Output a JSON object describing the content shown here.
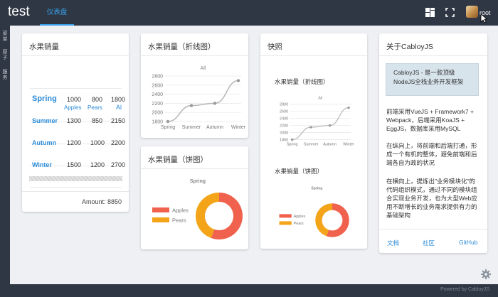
{
  "header": {
    "app_title": "test",
    "active_tab": "仪表盘",
    "user_name": "root"
  },
  "sidebar": {
    "items": [
      {
        "label": "菜单"
      },
      {
        "label": "原子"
      },
      {
        "label": "服务"
      }
    ]
  },
  "sales_table": {
    "title": "水果销量",
    "columns": [
      "Apples",
      "Pears",
      "Al"
    ],
    "rows": [
      {
        "season": "Spring",
        "apples": "1000",
        "pears": "800",
        "third": "1800"
      },
      {
        "season": "Summer",
        "apples": "1300",
        "pears": "850",
        "third": "2150"
      },
      {
        "season": "Autumn",
        "apples": "1200",
        "pears": "1000",
        "third": "2200"
      },
      {
        "season": "Winter",
        "apples": "1500",
        "pears": "1200",
        "third": "2700"
      }
    ],
    "amount_text": "Amount: 8850"
  },
  "line_card": {
    "title": "水果销量（折线图）"
  },
  "pie_card": {
    "title": "水果销量（饼图）"
  },
  "snapshot_card": {
    "title": "快照",
    "line_title": "水果销量（折线图）",
    "pie_title": "水果销量（饼图）"
  },
  "about_card": {
    "title": "关于CabloyJS",
    "highlight_line1": "CabloyJS - 是一款顶级",
    "highlight_line2": "NodeJS全栈业务开发框架",
    "p1": "前端采用VueJS + Framework7 + Webpack，后端采用KoaJS + EggJS，数据库采用MySQL",
    "p2": "在纵向上，将前端和后端打通，形成一个有机的整体，避免前端和后端各自为政的状况",
    "p3": "在横向上，提炼出\"业务模块化\"的代码组织模式，通过不同的模块组合实现业务开发，也为大型Web应用不断增长的业务需求提供有力的基础架构",
    "link_docs": "文档",
    "link_community": "社区",
    "link_github": "GitHub"
  },
  "footer": {
    "text": "Powered by CabloyJS"
  },
  "colors": {
    "topbar": "#2f3744",
    "accent": "#38a0ea",
    "apples": "#f0624d",
    "pears": "#f4a418",
    "line": "#b9b9b9"
  },
  "chart_data": [
    {
      "type": "line",
      "title": "All",
      "categories": [
        "Spring",
        "Summer",
        "Autumn",
        "Winter"
      ],
      "series": [
        {
          "name": "All",
          "values": [
            1800,
            2150,
            2200,
            2700
          ]
        }
      ],
      "yticks": [
        "2800",
        "2600",
        "2400",
        "2200",
        "2000",
        "1800"
      ],
      "ylim": [
        1800,
        2800
      ],
      "grid": true
    },
    {
      "type": "pie",
      "title": "Spring",
      "categories": [
        "Apples",
        "Pears"
      ],
      "values": [
        1000,
        800
      ],
      "legend": "left"
    }
  ]
}
